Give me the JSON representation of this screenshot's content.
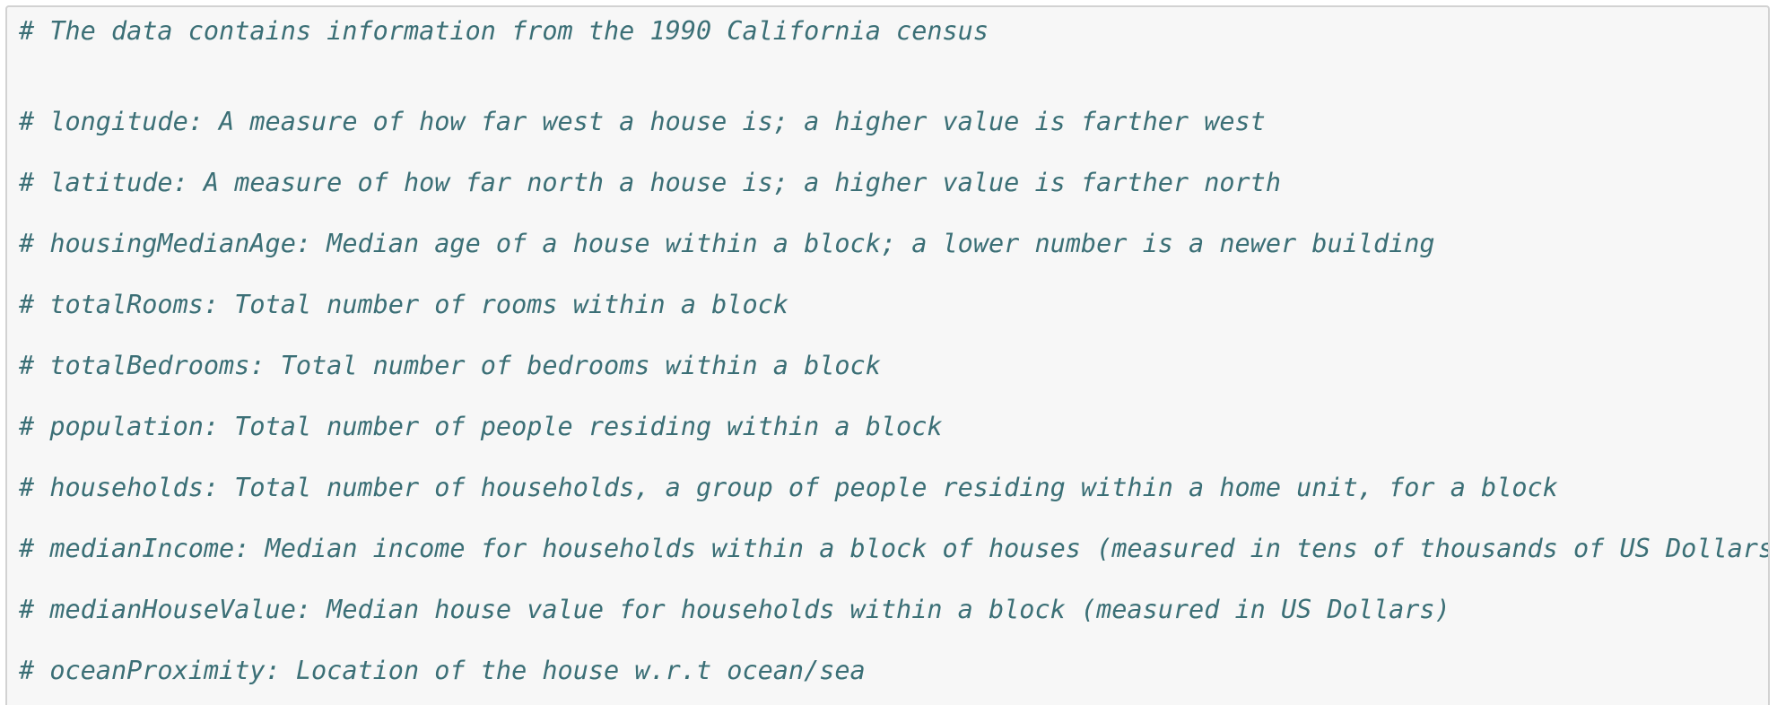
{
  "code_block": {
    "lines": [
      "# The data contains information from the 1990 California census",
      "# longitude: A measure of how far west a house is; a higher value is farther west",
      "# latitude: A measure of how far north a house is; a higher value is farther north",
      "# housingMedianAge: Median age of a house within a block; a lower number is a newer building",
      "# totalRooms: Total number of rooms within a block",
      "# totalBedrooms: Total number of bedrooms within a block",
      "# population: Total number of people residing within a block",
      "# households: Total number of households, a group of people residing within a home unit, for a block",
      "# medianIncome: Median income for households within a block of houses (measured in tens of thousands of US Dollars)",
      "# medianHouseValue: Median house value for households within a block (measured in US Dollars)",
      "# oceanProximity: Location of the house w.r.t ocean/sea"
    ]
  },
  "colors": {
    "background": "#f7f7f7",
    "comment_text": "#3b6f76",
    "border": "#d2d2d2"
  }
}
